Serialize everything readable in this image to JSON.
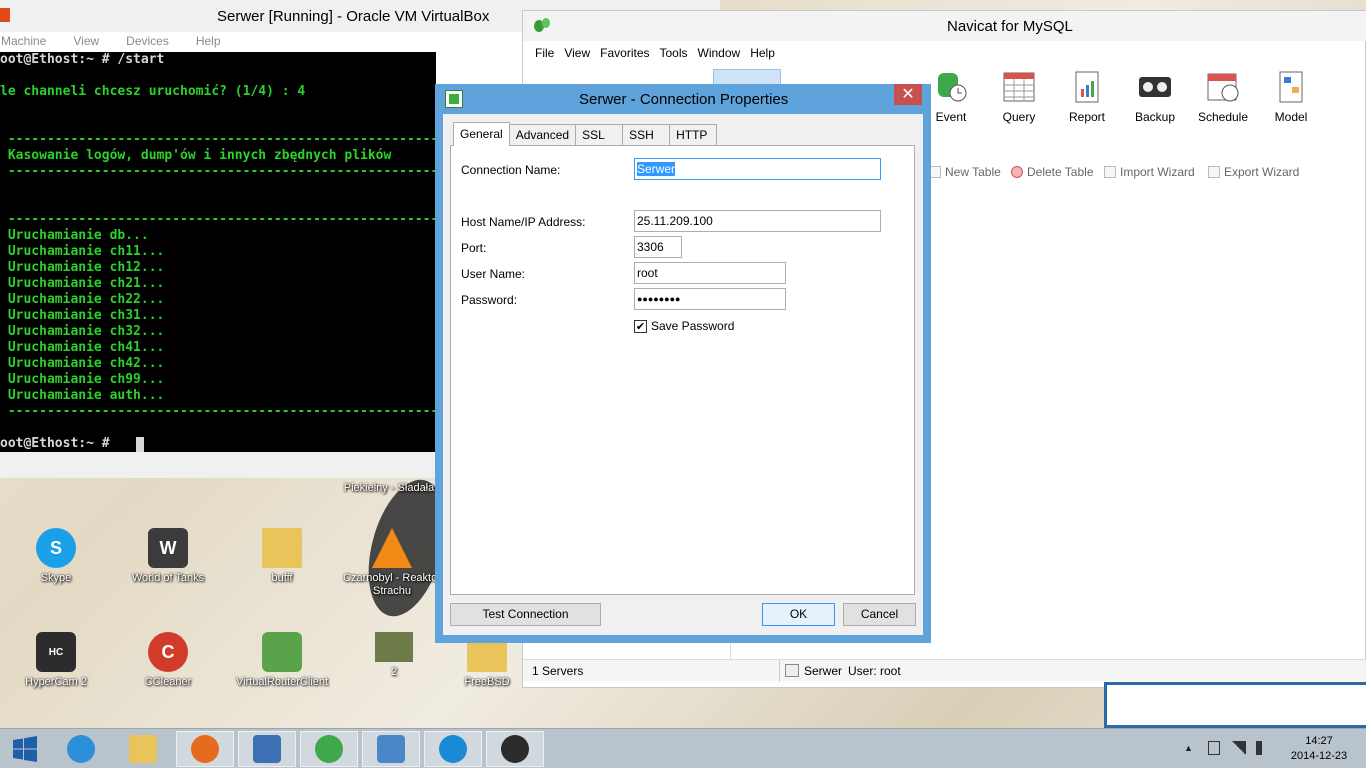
{
  "colors": {
    "terminal_green": "#2cd12c",
    "dialog_frame": "#5ea3db",
    "close_red": "#c75050",
    "selection_blue": "#3399ff"
  },
  "desktop": {
    "icons": [
      {
        "label": "Skype",
        "icon": "skype-icon"
      },
      {
        "label": "World of Tanks",
        "icon": "world-of-tanks-icon"
      },
      {
        "label": "bufff",
        "icon": "folder-icon"
      },
      {
        "label": "Czarnobyl - Reaktor Strachu",
        "icon": "vlc-icon"
      },
      {
        "label": "HyperCam 2",
        "icon": "hypercam-icon"
      },
      {
        "label": "CCleaner",
        "icon": "ccleaner-icon"
      },
      {
        "label": "VirtualRouterClient",
        "icon": "virtualrouter-icon"
      },
      {
        "label": "2",
        "icon": "image-thumbnail-icon"
      },
      {
        "label": "FreeBSD",
        "icon": "folder-icon"
      }
    ],
    "top_label": "Piekielny - Sładała"
  },
  "vbox": {
    "title": "Serwer [Running] - Oracle VM VirtualBox",
    "menu": [
      "Machine",
      "View",
      "Devices",
      "Help"
    ],
    "terminal_lines": [
      "oot@Ethost:~ # /start",
      "le channeli chcesz uruchomić? (1/4) : 4",
      "",
      " ------------------------------------------------------------------",
      " Kasowanie logów, dump'ów i innych zbędnych plików",
      " ------------------------------------------------------------------",
      "",
      "",
      " ------------------------------------------------------------------",
      " Uruchamianie db...",
      " Uruchamianie ch11...",
      " Uruchamianie ch12...",
      " Uruchamianie ch21...",
      " Uruchamianie ch22...",
      " Uruchamianie ch31...",
      " Uruchamianie ch32...",
      " Uruchamianie ch41...",
      " Uruchamianie ch42...",
      " Uruchamianie ch99...",
      " Uruchamianie auth...",
      " ------------------------------------------------------------------",
      "",
      "oot@Ethost:~ # "
    ]
  },
  "navicat": {
    "title": "Navicat for MySQL",
    "menu": [
      "File",
      "View",
      "Favorites",
      "Tools",
      "Window",
      "Help"
    ],
    "toolbar": [
      {
        "label": "Event",
        "icon": "event-icon"
      },
      {
        "label": "Query",
        "icon": "query-icon"
      },
      {
        "label": "Report",
        "icon": "report-icon"
      },
      {
        "label": "Backup",
        "icon": "backup-icon"
      },
      {
        "label": "Schedule",
        "icon": "schedule-icon"
      },
      {
        "label": "Model",
        "icon": "model-icon"
      }
    ],
    "subtoolbar": [
      {
        "label": "New Table",
        "icon": "new-table-icon"
      },
      {
        "label": "Delete Table",
        "icon": "delete-table-icon"
      },
      {
        "label": "Import Wizard",
        "icon": "import-wizard-icon"
      },
      {
        "label": "Export Wizard",
        "icon": "export-wizard-icon"
      }
    ],
    "status": {
      "servers": "1 Servers",
      "connection": "Serwer",
      "user": "User: root"
    }
  },
  "dialog": {
    "title": "Serwer - Connection Properties",
    "close_glyph": "✕",
    "tabs": [
      "General",
      "Advanced",
      "SSL",
      "SSH",
      "HTTP"
    ],
    "active_tab": "General",
    "fields": {
      "connection_name_label": "Connection Name:",
      "connection_name": "Serwer",
      "host_label": "Host Name/IP Address:",
      "host": "25.11.209.100",
      "port_label": "Port:",
      "port": "3306",
      "user_label": "User Name:",
      "user": "root",
      "password_label": "Password:",
      "password": "●●●●●●●●"
    },
    "save_password": {
      "label": "Save Password",
      "checked": true,
      "glyph": "✔"
    },
    "buttons": {
      "test": "Test Connection",
      "ok": "OK",
      "cancel": "Cancel"
    }
  },
  "taskbar": {
    "apps": [
      "windows-start-icon",
      "internet-explorer-icon",
      "file-explorer-icon",
      "firefox-icon",
      "virtualbox-icon",
      "navicat-icon",
      "network-app-icon",
      "hamachi-icon",
      "lemur-app-icon"
    ],
    "clock_time": "14:27",
    "clock_date": "2014-12-23",
    "tray_glyph": "▲"
  }
}
